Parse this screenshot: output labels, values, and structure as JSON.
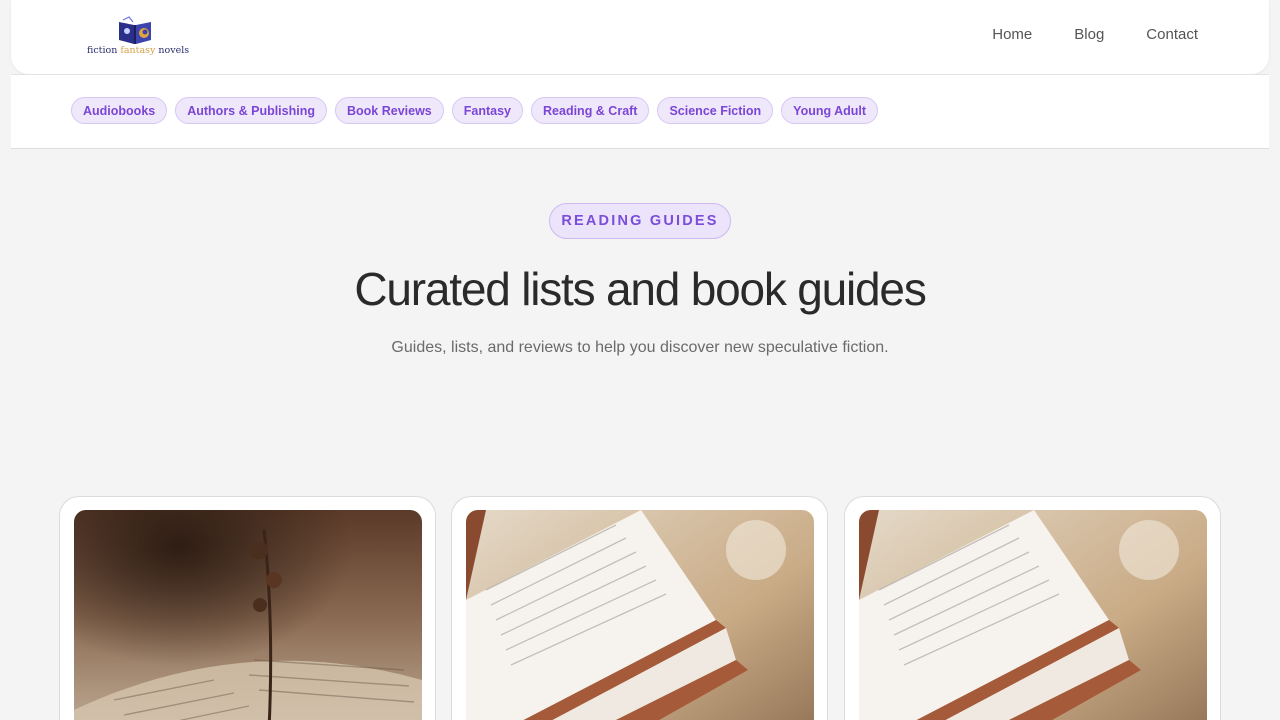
{
  "logo": {
    "word1": "fiction ",
    "word2": "fantasy",
    "word3": " novels"
  },
  "nav": {
    "home": "Home",
    "blog": "Blog",
    "contact": "Contact"
  },
  "categories": [
    "Audiobooks",
    "Authors & Publishing",
    "Book Reviews",
    "Fantasy",
    "Reading & Craft",
    "Science Fiction",
    "Young Adult"
  ],
  "hero": {
    "eyebrow": "READING GUIDES",
    "title": "Curated lists and book guides",
    "subtitle": "Guides, lists, and reviews to help you discover new speculative fiction."
  },
  "cards": [
    {
      "image_icon": "dried-flowers-on-book-image"
    },
    {
      "image_icon": "open-book-pages-image"
    },
    {
      "image_icon": "open-book-pages-image"
    }
  ],
  "colors": {
    "accent": "#7b45d6",
    "pill_bg": "#efe8fb",
    "page_bg": "#f4f4f4"
  }
}
